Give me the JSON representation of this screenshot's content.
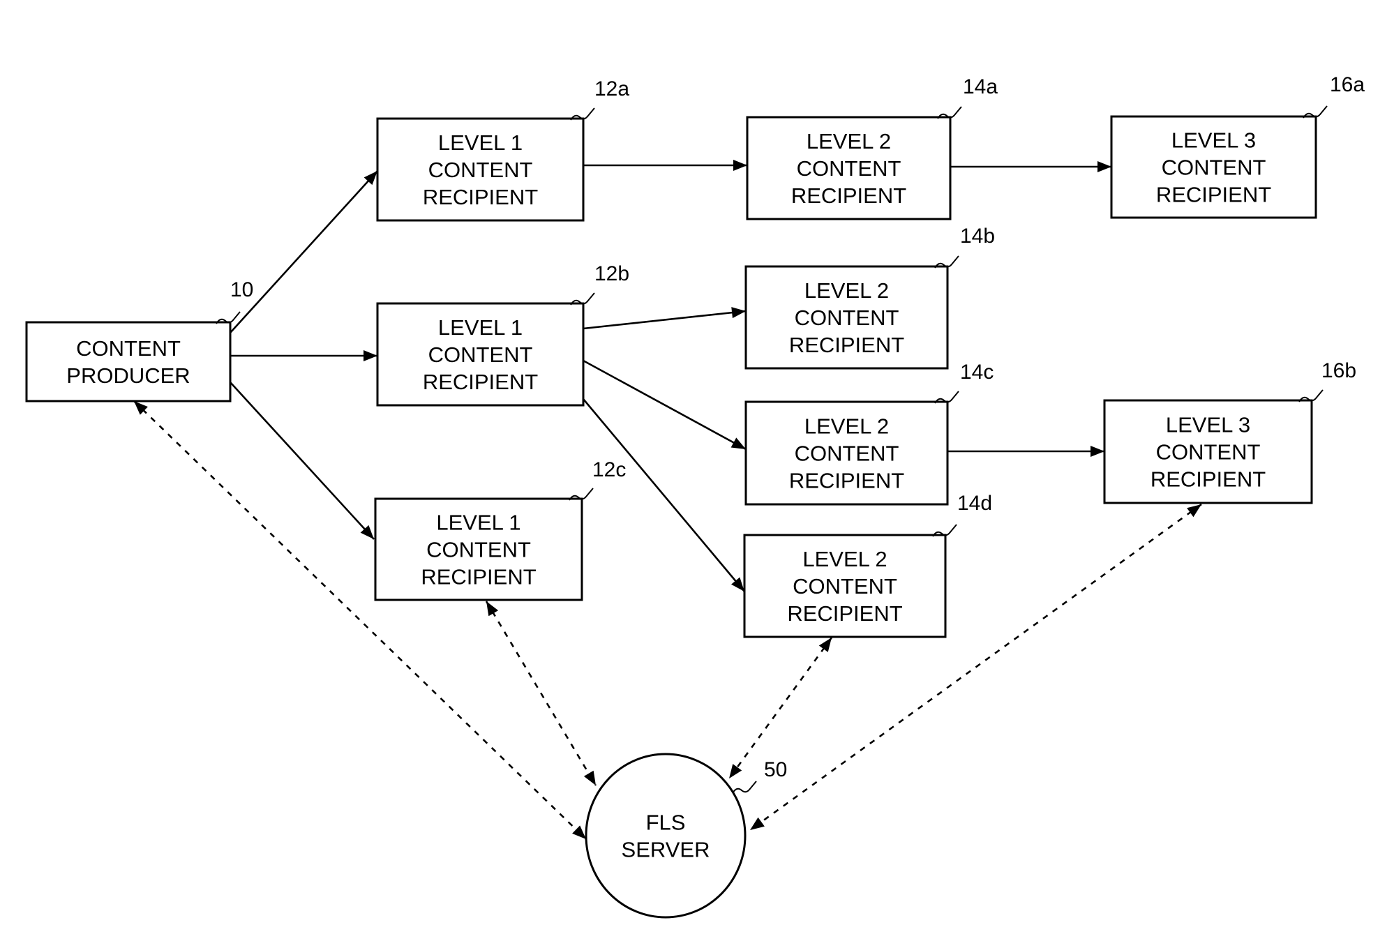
{
  "diagram": {
    "title": "",
    "nodes": [
      {
        "id": "10",
        "ref": "10",
        "lines": [
          "CONTENT",
          "PRODUCER"
        ]
      },
      {
        "id": "12a",
        "ref": "12a",
        "lines": [
          "LEVEL 1",
          "CONTENT",
          "RECIPIENT"
        ]
      },
      {
        "id": "12b",
        "ref": "12b",
        "lines": [
          "LEVEL 1",
          "CONTENT",
          "RECIPIENT"
        ]
      },
      {
        "id": "12c",
        "ref": "12c",
        "lines": [
          "LEVEL 1",
          "CONTENT",
          "RECIPIENT"
        ]
      },
      {
        "id": "14a",
        "ref": "14a",
        "lines": [
          "LEVEL 2",
          "CONTENT",
          "RECIPIENT"
        ]
      },
      {
        "id": "14b",
        "ref": "14b",
        "lines": [
          "LEVEL 2",
          "CONTENT",
          "RECIPIENT"
        ]
      },
      {
        "id": "14c",
        "ref": "14c",
        "lines": [
          "LEVEL 2",
          "CONTENT",
          "RECIPIENT"
        ]
      },
      {
        "id": "14d",
        "ref": "14d",
        "lines": [
          "LEVEL 2",
          "CONTENT",
          "RECIPIENT"
        ]
      },
      {
        "id": "16a",
        "ref": "16a",
        "lines": [
          "LEVEL 3",
          "CONTENT",
          "RECIPIENT"
        ]
      },
      {
        "id": "16b",
        "ref": "16b",
        "lines": [
          "LEVEL 3",
          "CONTENT",
          "RECIPIENT"
        ]
      },
      {
        "id": "50",
        "ref": "50",
        "lines": [
          "FLS",
          "SERVER"
        ],
        "shape": "circle"
      }
    ],
    "edges": [
      {
        "from": "10",
        "to": "12a",
        "style": "solid",
        "direction": "forward"
      },
      {
        "from": "10",
        "to": "12b",
        "style": "solid",
        "direction": "forward"
      },
      {
        "from": "10",
        "to": "12c",
        "style": "solid",
        "direction": "forward"
      },
      {
        "from": "12a",
        "to": "14a",
        "style": "solid",
        "direction": "forward"
      },
      {
        "from": "14a",
        "to": "16a",
        "style": "solid",
        "direction": "forward"
      },
      {
        "from": "12b",
        "to": "14b",
        "style": "solid",
        "direction": "forward"
      },
      {
        "from": "12b",
        "to": "14c",
        "style": "solid",
        "direction": "forward"
      },
      {
        "from": "12b",
        "to": "14d",
        "style": "solid",
        "direction": "forward"
      },
      {
        "from": "14c",
        "to": "16b",
        "style": "solid",
        "direction": "forward"
      },
      {
        "from": "10",
        "to": "50",
        "style": "dashed",
        "direction": "both"
      },
      {
        "from": "12c",
        "to": "50",
        "style": "dashed",
        "direction": "both"
      },
      {
        "from": "14d",
        "to": "50",
        "style": "dashed",
        "direction": "both"
      },
      {
        "from": "16b",
        "to": "50",
        "style": "dashed",
        "direction": "both"
      }
    ]
  }
}
